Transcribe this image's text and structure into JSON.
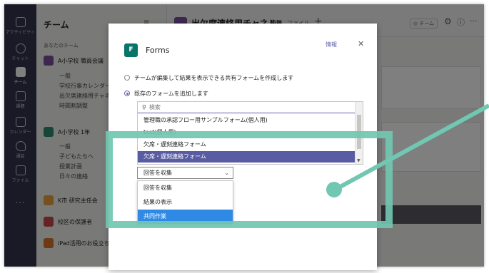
{
  "colors": {
    "rail_bg": "#33344a",
    "accent": "#6264a7",
    "forms_green": "#077568",
    "selected_row": "#5a5ca3",
    "menu_highlight": "#2f8ae6",
    "annotation": "#71c7b1"
  },
  "app_rail": {
    "items": [
      {
        "label": "アクティビティ",
        "icon": "bell-icon"
      },
      {
        "label": "チャット",
        "icon": "chat-icon"
      },
      {
        "label": "チーム",
        "icon": "teams-icon"
      },
      {
        "label": "課題",
        "icon": "assignments-icon"
      },
      {
        "label": "カレンダー",
        "icon": "calendar-icon"
      },
      {
        "label": "通話",
        "icon": "phone-icon"
      },
      {
        "label": "ファイル",
        "icon": "files-icon"
      }
    ],
    "more": "..."
  },
  "teams_panel": {
    "header": "チーム",
    "filter": "≡",
    "section": "あなたのチーム",
    "teams": [
      {
        "name": "A小学校 職員会議",
        "color": "#7b4f9d"
      },
      {
        "name": "A小学校 1年",
        "color": "#2f8a6e"
      },
      {
        "name": "K市 研究主任会",
        "color": "#e8a33d"
      },
      {
        "name": "校区の保護者",
        "color": "#c9474b"
      },
      {
        "name": "iPad活用のお役立ち",
        "color": "#d8742a"
      }
    ],
    "channels_team1": [
      "一般",
      "学校行事カレンダー",
      "出欠席連絡用チャネル",
      "時間割調整"
    ],
    "channels_team2": [
      "一般",
      "子どもたちへ",
      "授業計画",
      "日々の連絡"
    ]
  },
  "main": {
    "channel_title": "出欠席連絡用チャネル",
    "tab_posts": "投稿",
    "tab_files": "ファイル",
    "tab_add": "+",
    "team_button": "◎ チーム",
    "gear": "⚙",
    "info": "ⓘ",
    "more": "···"
  },
  "dialog": {
    "logo": "F",
    "title": "Forms",
    "info_link": "情報",
    "close": "✕",
    "option_create": "チームが編集して結果を表示できる共有フォームを作成します",
    "option_existing": "既存のフォームを追加します",
    "search_placeholder": "検索",
    "search_icon": "⚲",
    "forms": [
      "管理職の承認フロー用サンプルフォーム(個人用)",
      "test(個人用)",
      "欠席・遅刻連絡フォーム",
      "欠席・遅刻連絡フォーム"
    ],
    "selected_form_index": 3,
    "collect_select": {
      "value": "回答を収集",
      "chevron": "⌄",
      "options": [
        "回答を収集",
        "結果の表示",
        "共同作業"
      ],
      "highlighted_index": 2
    }
  }
}
